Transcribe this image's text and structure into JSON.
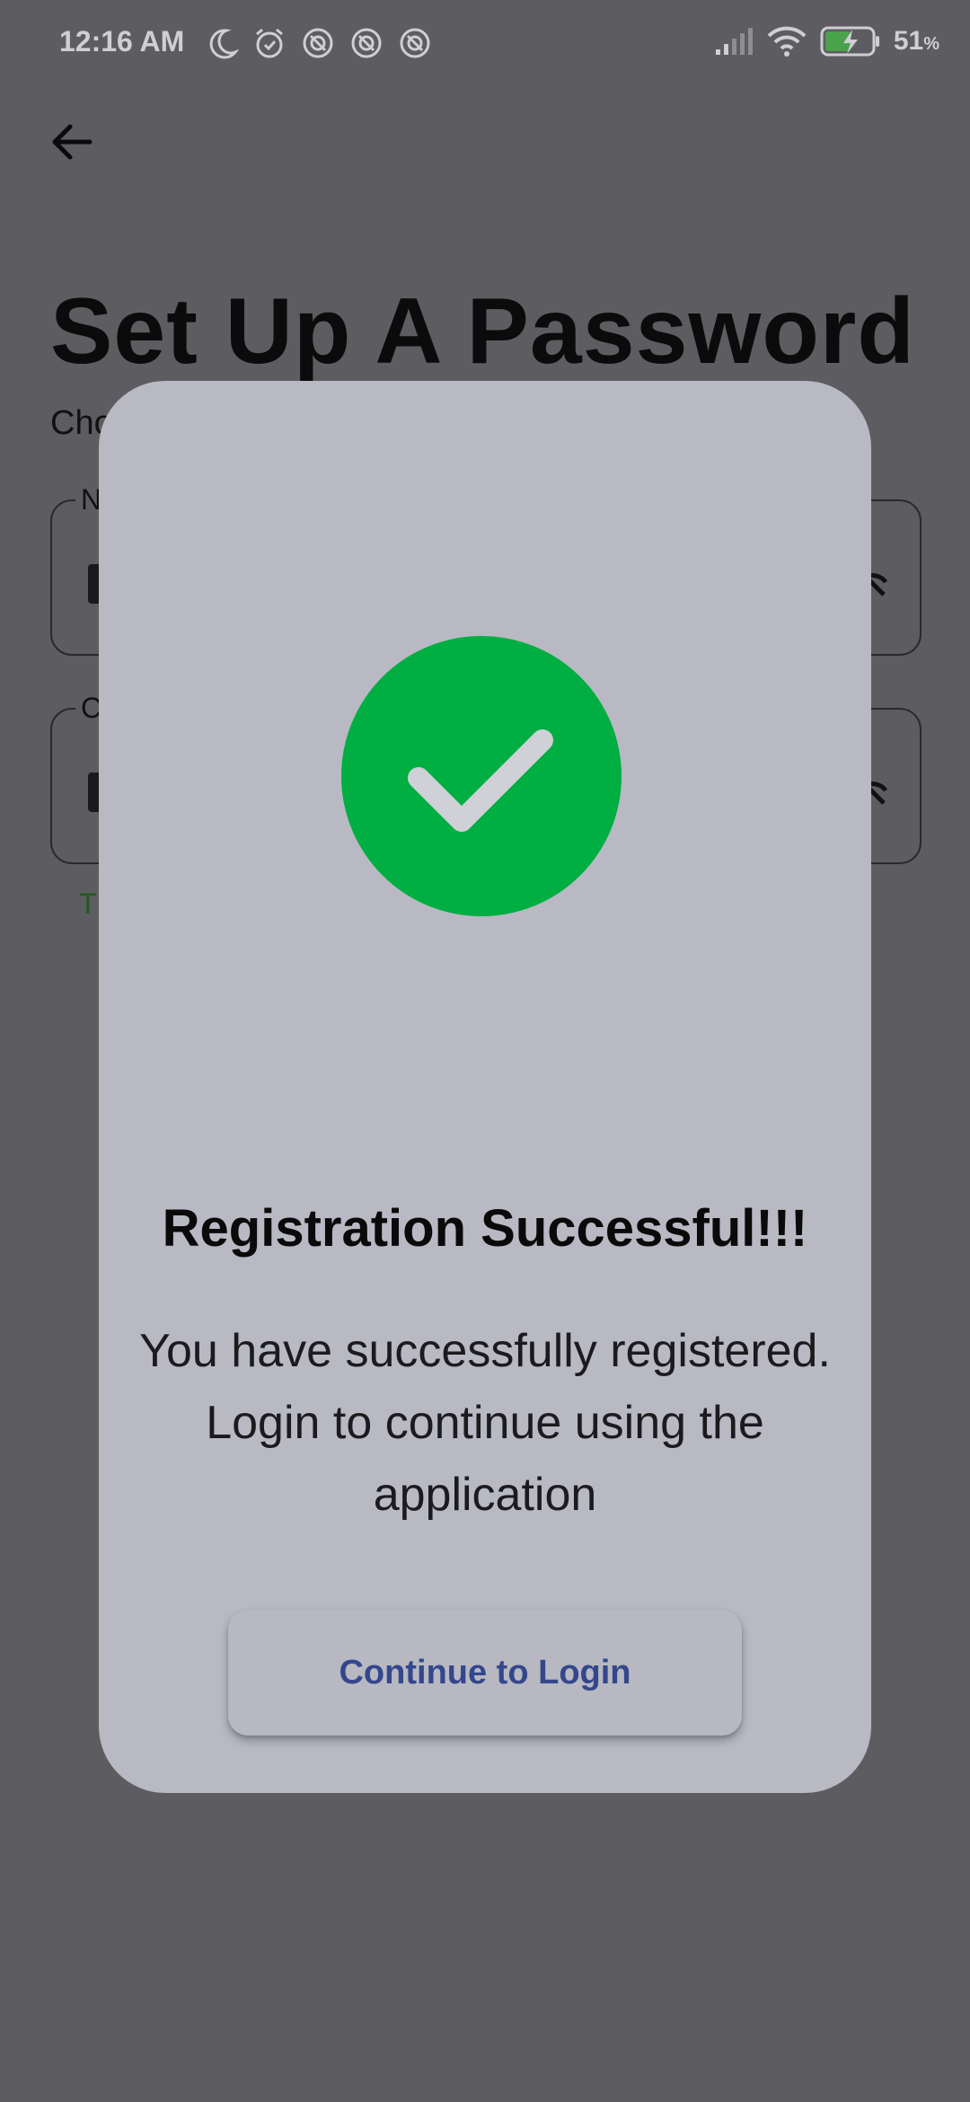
{
  "status_bar": {
    "time": "12:16 AM",
    "battery": "51",
    "battery_unit": "%",
    "left_icons": [
      "moon-icon",
      "alarm-icon",
      "app-icon",
      "app-icon",
      "app-icon"
    ],
    "right_icons": [
      "signal-icon",
      "wifi-icon",
      "battery-charging-icon"
    ]
  },
  "screen": {
    "title": "Set Up A Password",
    "subtitle_visible": "Cho",
    "field1_label_visible": "N",
    "field2_label_visible": "C",
    "hint_visible": "T"
  },
  "dialog": {
    "icon": "check-circle-icon",
    "title": "Registration Successful!!!",
    "message": "You have successfully registered. Login to continue using the application",
    "button_label": "Continue to Login"
  },
  "colors": {
    "scrim": "#5d5c60",
    "dialog_bg": "#b8b9c3",
    "success_green": "#00ae42",
    "button_text": "#34478c"
  }
}
